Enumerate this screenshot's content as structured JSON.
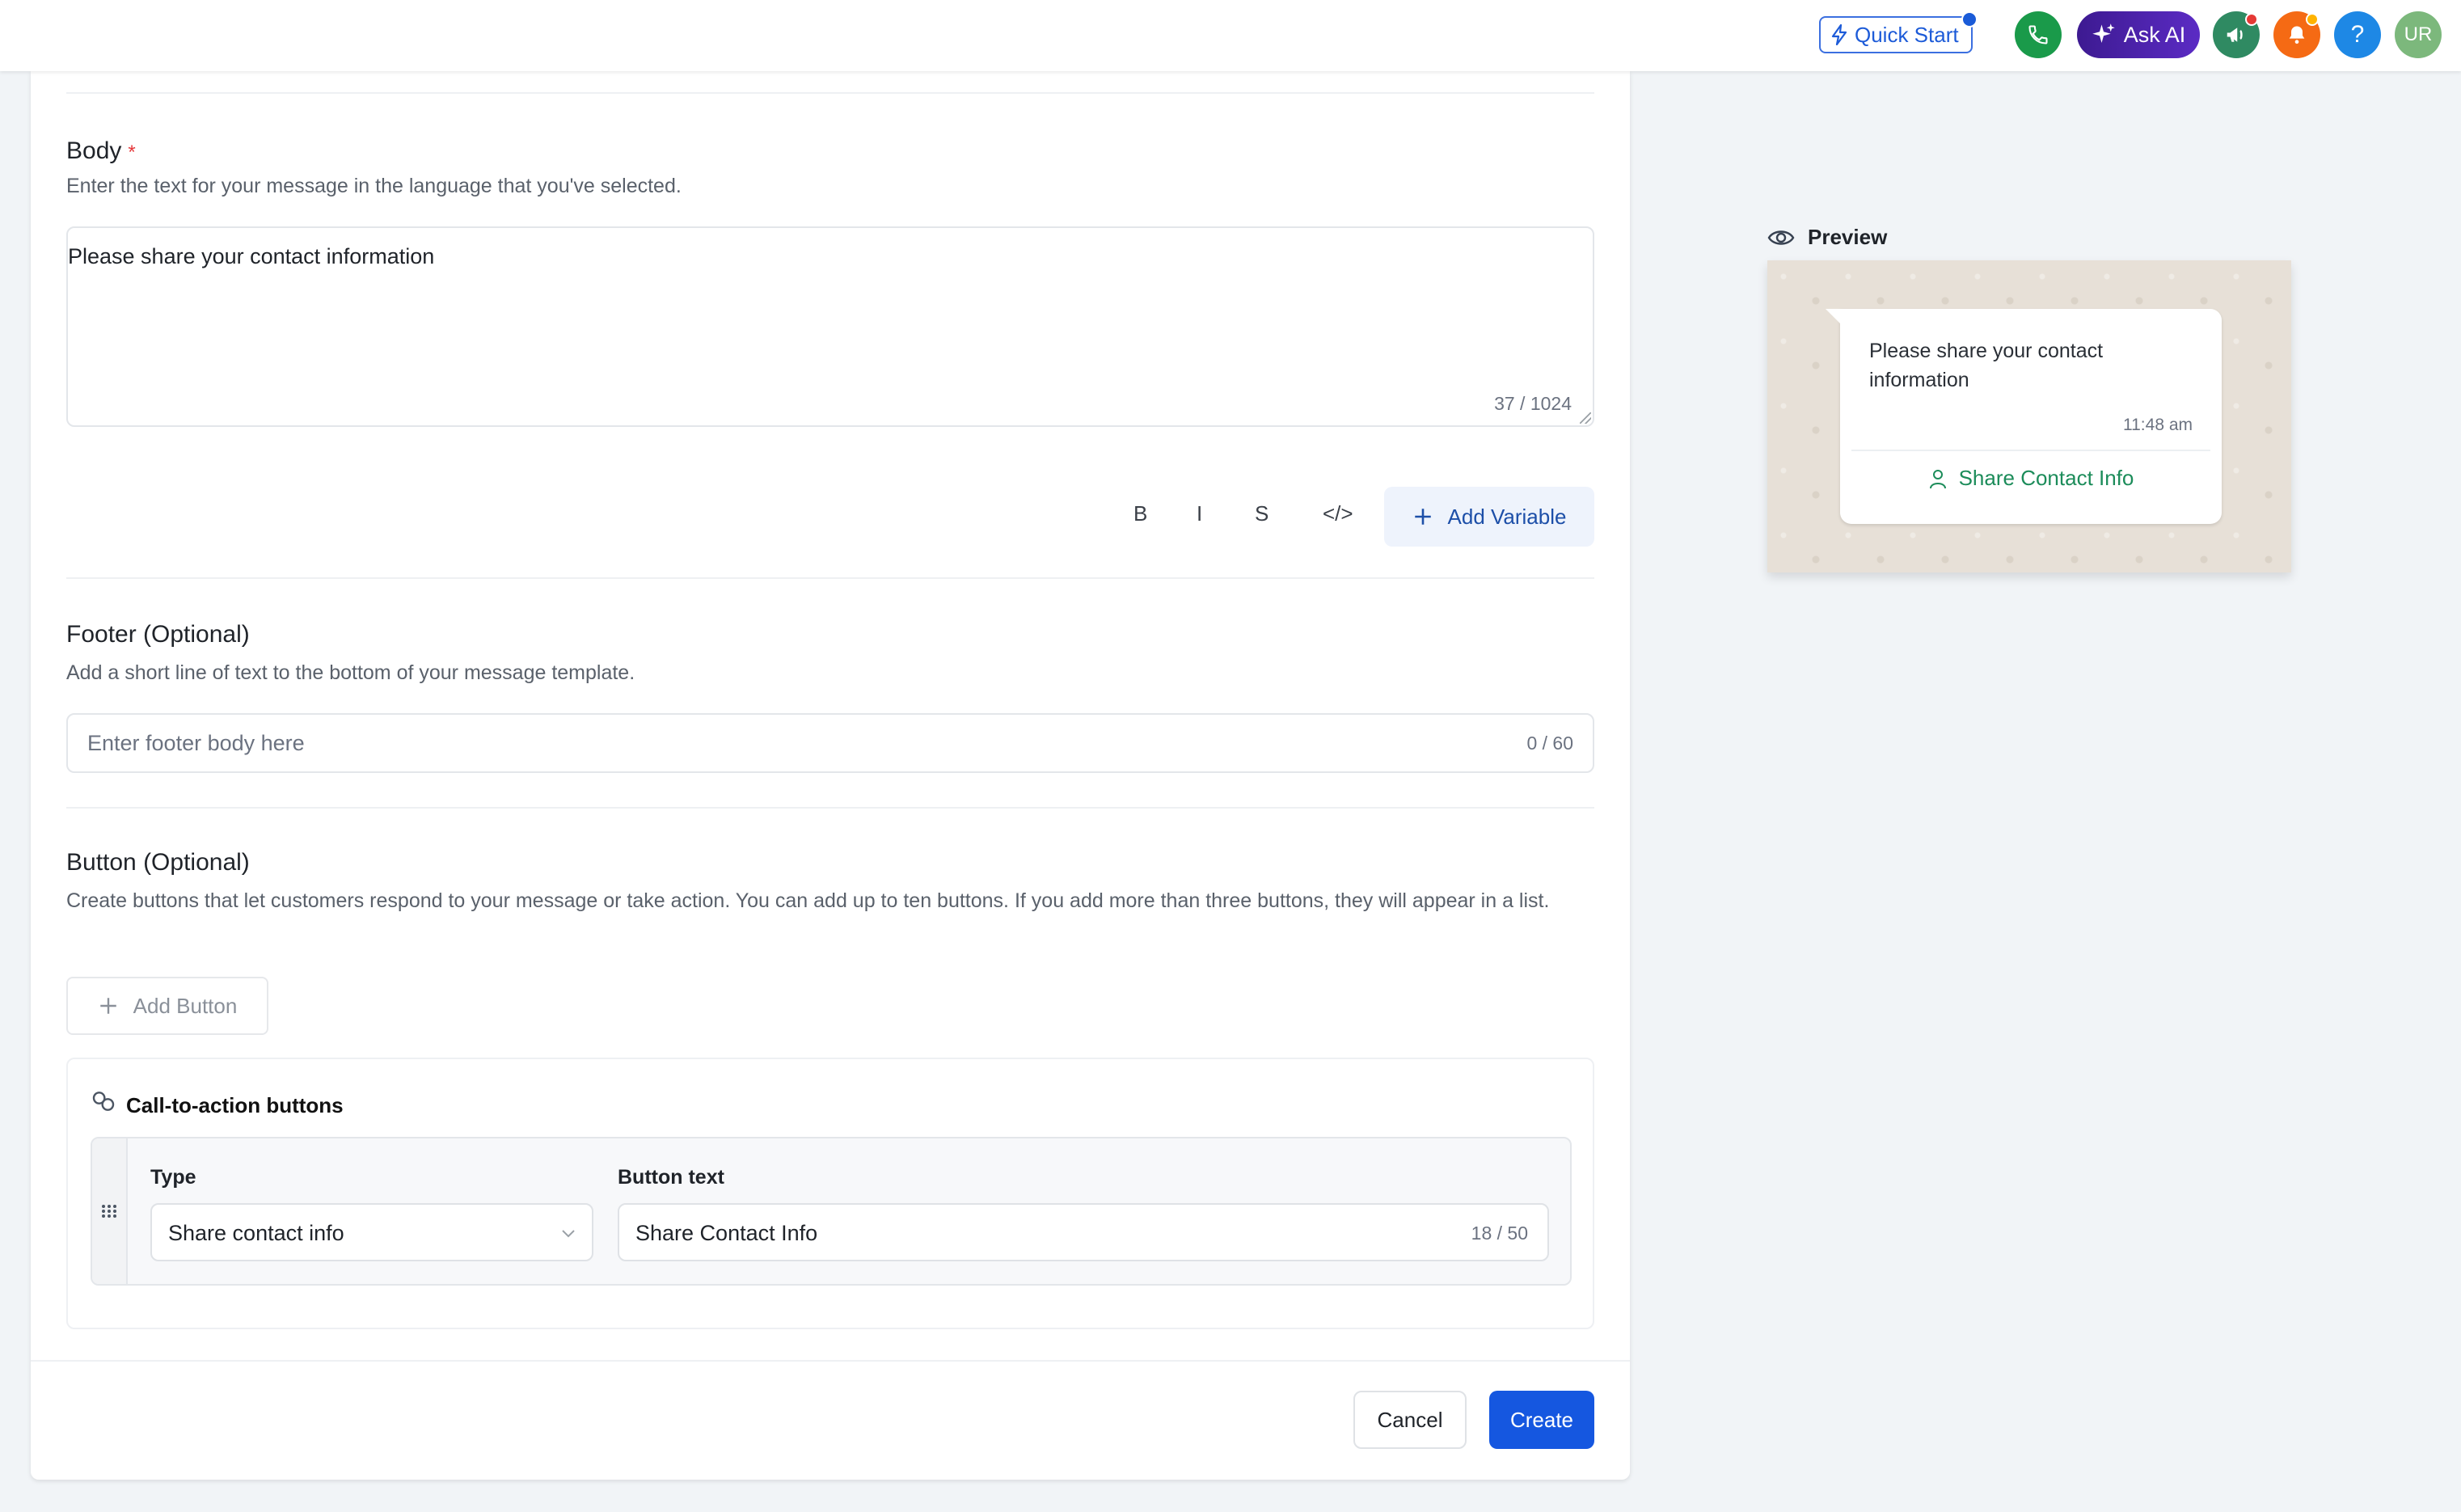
{
  "topbar": {
    "quick_start": "Quick Start",
    "ask_ai": "Ask AI",
    "help": "?",
    "avatar": "UR",
    "colors": {
      "phone": "#1a9a4a",
      "ask_ai": "#4a23ad",
      "megaphone": "#2f8a62",
      "bell": "#f56a14",
      "help": "#1e88e5",
      "avatar": "#7cb87c"
    }
  },
  "body_section": {
    "label": "Body",
    "required_mark": "*",
    "hint": "Enter the text for your message in the language that you've selected.",
    "value": "Please share your contact information",
    "counter": "37 / 1024"
  },
  "format_toolbar": {
    "bold": "B",
    "italic": "I",
    "strike": "S",
    "code": "</>",
    "add_variable": "Add Variable"
  },
  "footer_section": {
    "label": "Footer (Optional)",
    "hint": "Add a short line of text to the bottom of your message template.",
    "placeholder": "Enter footer body here",
    "counter": "0 / 60"
  },
  "button_section": {
    "label": "Button (Optional)",
    "hint": "Create buttons that let customers respond to your message or take action. You can add up to ten buttons. If you add more than three buttons, they will appear in a list.",
    "add_button": "Add Button",
    "cta": {
      "title": "Call-to-action buttons",
      "type_label": "Type",
      "type_value": "Share contact info",
      "text_label": "Button text",
      "text_value": "Share Contact Info",
      "text_counter": "18 / 50"
    }
  },
  "actions": {
    "cancel": "Cancel",
    "create": "Create"
  },
  "preview": {
    "title": "Preview",
    "message": "Please share your contact information",
    "time": "11:48 am",
    "button": "Share Contact Info"
  }
}
